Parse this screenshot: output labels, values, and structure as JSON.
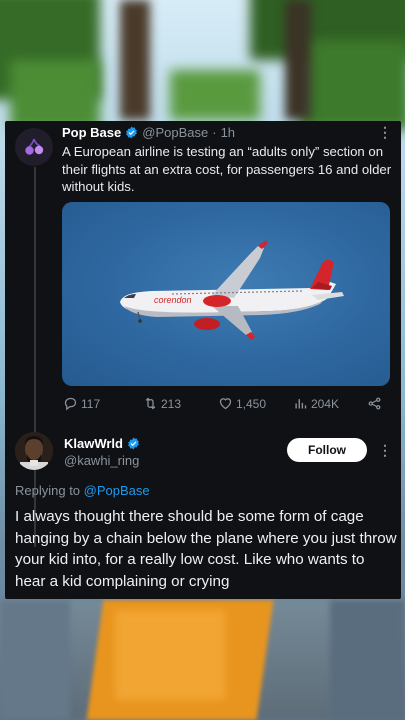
{
  "original_post": {
    "author_name": "Pop Base",
    "author_handle": "@PopBase",
    "separator": "·",
    "time": "1h",
    "text": "A European airline is testing an “adults only” section on their flights at an extra cost, for passengers 16 and older without kids.",
    "media_brand": "corendon",
    "stats": {
      "replies": "117",
      "reposts": "213",
      "likes": "1,450",
      "views": "204K"
    }
  },
  "reply": {
    "author_name": "KlawWrld",
    "author_handle": "@kawhi_ring",
    "follow_label": "Follow",
    "replying_prefix": "Replying to",
    "replying_to": "@PopBase",
    "text": "I always thought there should be some form of cage hanging by a chain below the plane where you just throw your kid into, for a really low cost. Like who wants to hear a kid complaining or crying"
  },
  "colors": {
    "card_bg": "#0f1115",
    "accent_blue": "#1d9bf0",
    "muted": "#8b939c",
    "airline_red": "#d4252b"
  },
  "icons": [
    "verified-badge-icon",
    "more-icon",
    "reply-icon",
    "repost-icon",
    "like-icon",
    "views-icon",
    "share-icon"
  ]
}
